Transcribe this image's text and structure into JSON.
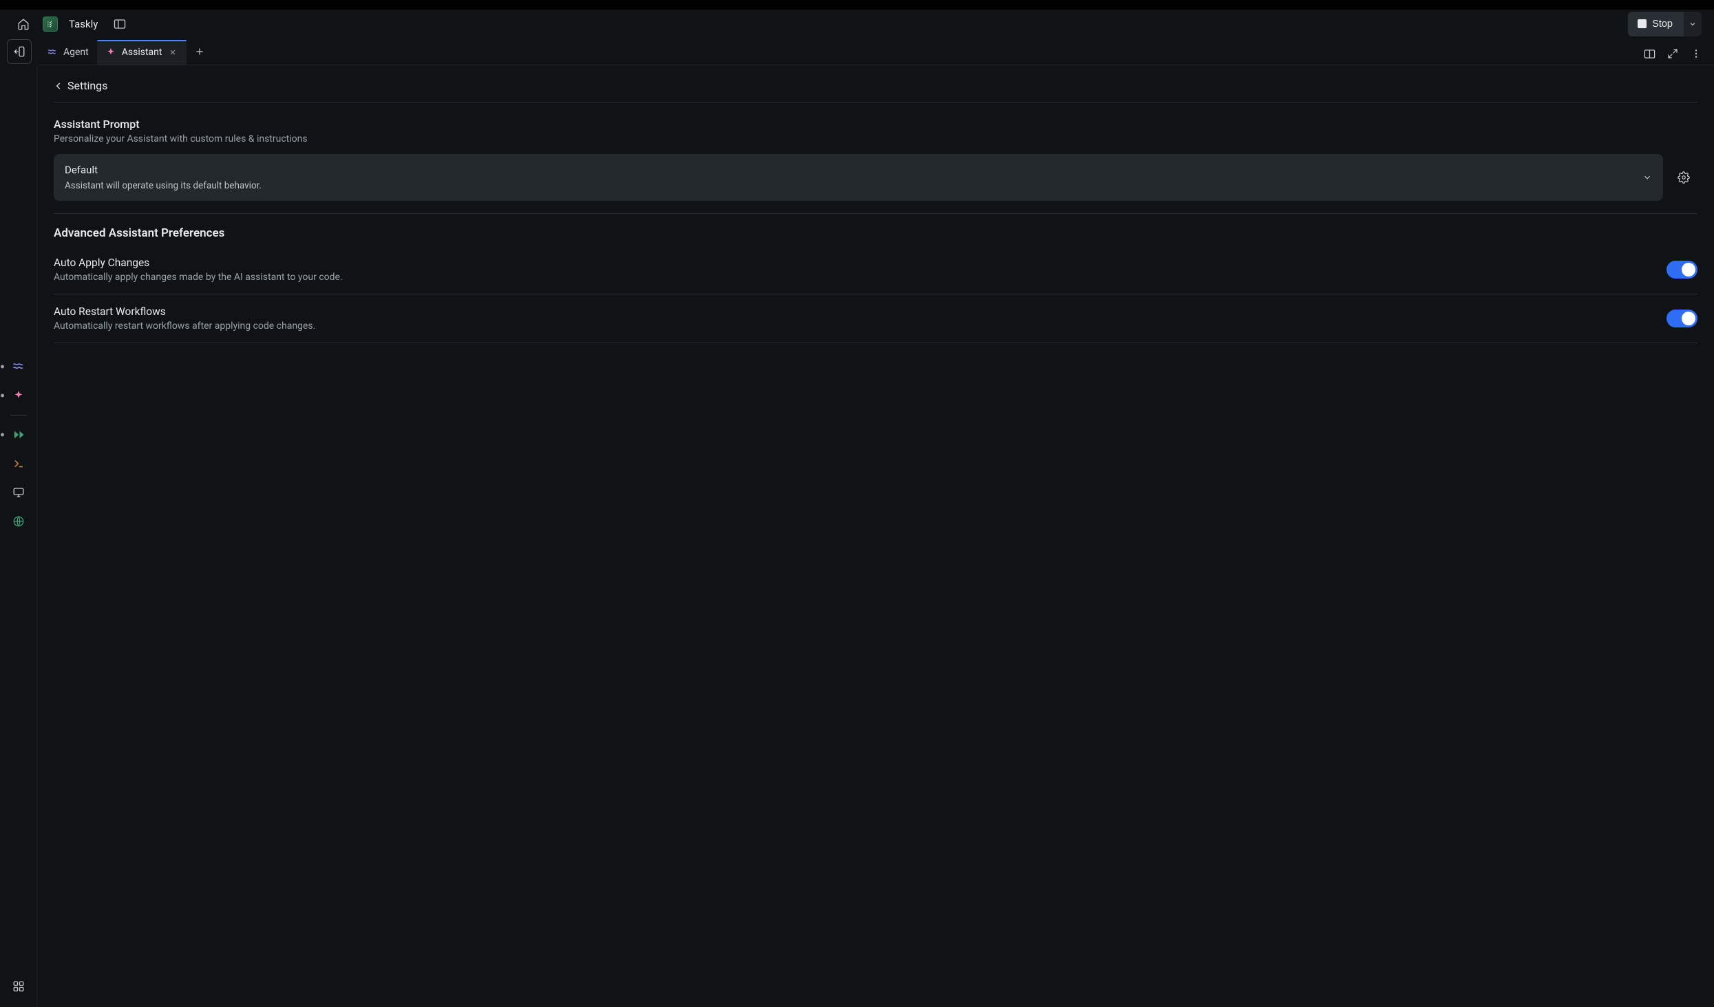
{
  "header": {
    "app_name": "Taskly",
    "stop_label": "Stop"
  },
  "tabs": [
    {
      "label": "Agent"
    },
    {
      "label": "Assistant"
    }
  ],
  "settings": {
    "back_label": "Settings",
    "prompt": {
      "title": "Assistant Prompt",
      "subtitle": "Personalize your Assistant with custom rules & instructions",
      "selected_title": "Default",
      "selected_sub": "Assistant will operate using its default behavior."
    },
    "advanced_title": "Advanced Assistant Preferences",
    "prefs": [
      {
        "title": "Auto Apply Changes",
        "subtitle": "Automatically apply changes made by the AI assistant to your code.",
        "on": true
      },
      {
        "title": "Auto Restart Workflows",
        "subtitle": "Automatically restart workflows after applying code changes.",
        "on": true
      }
    ]
  },
  "icons": {
    "home": "home-icon",
    "panel": "panel-icon",
    "git": "git-icon",
    "waves": "waves-icon",
    "sparkle": "sparkle-icon",
    "play": "play-icon",
    "terminal": "terminal-icon",
    "monitor": "monitor-icon",
    "globe": "globe-icon",
    "apps": "apps-icon"
  },
  "colors": {
    "accent": "#2f6df4",
    "tab_accent": "#4a86ff",
    "icon_purple": "#8b8cf2",
    "icon_green": "#3fa77a",
    "icon_orange": "#e08b2e"
  }
}
